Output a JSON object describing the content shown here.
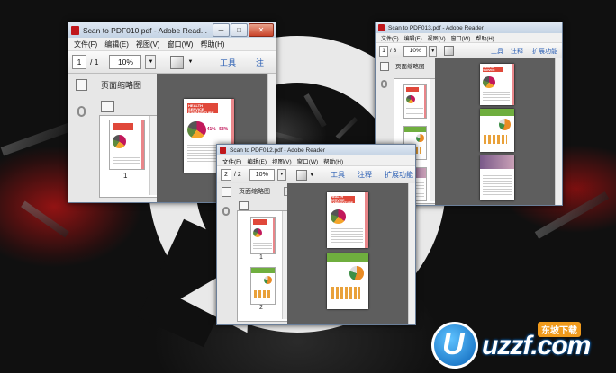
{
  "colors": {
    "accent_link": "#2b5fb4",
    "pdf_red": "#c0161b",
    "titlebar": "#c4d3e4",
    "doc_bg": "#5e5e5e"
  },
  "win1": {
    "title": "Scan to PDF010.pdf - Adobe Read...",
    "menu": [
      "文件(F)",
      "编辑(E)",
      "视图(V)",
      "窗口(W)",
      "帮助(H)"
    ],
    "page_current": "1",
    "page_total": "/ 1",
    "zoom": "10%",
    "tools_link": "工具",
    "annot_link": "注",
    "panel_title": "页面缩略图",
    "thumb_labels": [
      "1"
    ],
    "page_heading": "HEALTH SERVICE EXPENDITURE",
    "stat_a": "41%",
    "stat_b": "53%"
  },
  "win2": {
    "title": "Scan to PDF013.pdf - Adobe Reader",
    "menu": [
      "文件(F)",
      "编辑(E)",
      "视图(V)",
      "窗口(W)",
      "帮助(H)"
    ],
    "page_current": "1",
    "page_total": "/ 3",
    "zoom": "10%",
    "tools_link": "工具",
    "annot_link": "注释",
    "share_link": "扩展功能",
    "panel_title": "页面缩略图",
    "page_heading": "HEALTH SERVICE EXPENDITURE"
  },
  "win3": {
    "title": "Scan to PDF012.pdf - Adobe Reader",
    "menu": [
      "文件(F)",
      "编辑(E)",
      "视图(V)",
      "窗口(W)",
      "帮助(H)"
    ],
    "page_current": "2",
    "page_total": "/ 2",
    "zoom": "10%",
    "tools_link": "工具",
    "annot_link": "注释",
    "share_link": "扩展功能",
    "panel_title": "页面缩略图",
    "thumb_labels": [
      "1",
      "2"
    ],
    "page_heading": "HEALTH SERVICE EXPENDITURE"
  },
  "window_controls": {
    "minimize": "─",
    "maximize": "□",
    "close": "✕"
  },
  "logo": {
    "mark": "U",
    "text": "uzzf.com",
    "badge": "东坡下载"
  }
}
